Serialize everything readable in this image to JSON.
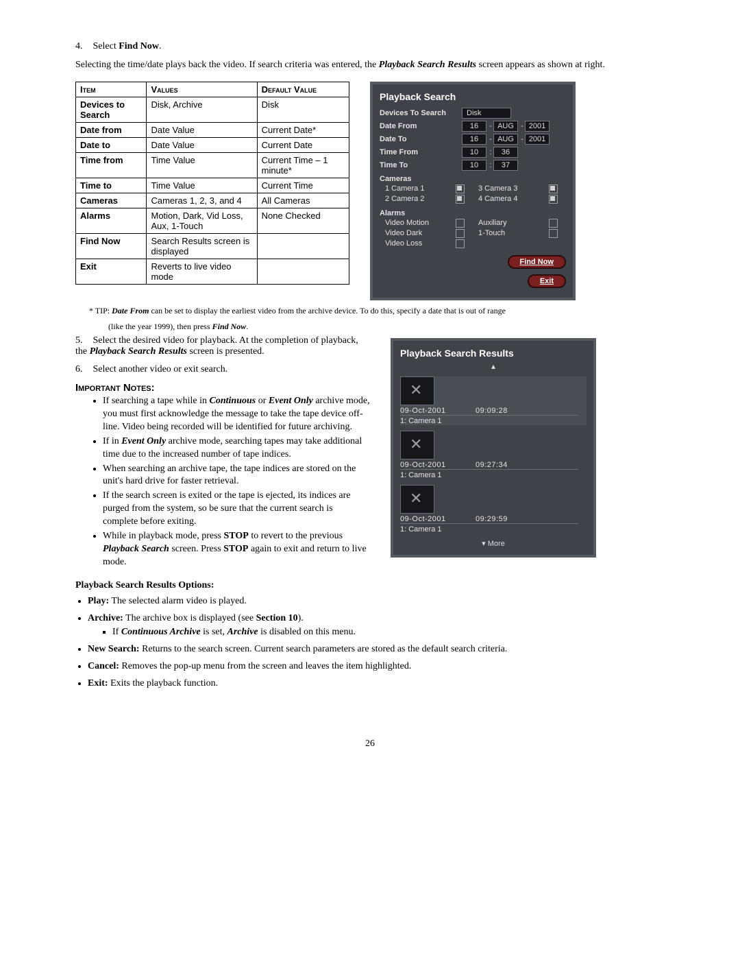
{
  "step4": {
    "num": "4.",
    "text_a": "Select ",
    "bold": "Find Now",
    "text_b": "."
  },
  "intro": {
    "a": "Selecting the time/date plays back the video. If search criteria was entered, the ",
    "bi": "Playback Search Results",
    "b": " screen appears as shown at right."
  },
  "table": {
    "headers": [
      "Item",
      "Values",
      "Default Value"
    ],
    "rows": [
      {
        "item": "Devices to Search",
        "values": "Disk, Archive",
        "default": "Disk"
      },
      {
        "item": "Date from",
        "values": "Date Value",
        "default": "Current Date*"
      },
      {
        "item": "Date to",
        "values": "Date Value",
        "default": "Current Date"
      },
      {
        "item": "Time from",
        "values": "Time Value",
        "default": "Current Time – 1 minute*"
      },
      {
        "item": "Time to",
        "values": "Time Value",
        "default": "Current Time"
      },
      {
        "item": "Cameras",
        "values": "Cameras 1, 2, 3, and 4",
        "default": "All Cameras"
      },
      {
        "item": "Alarms",
        "values": "Motion, Dark, Vid Loss, Aux, 1-Touch",
        "default": "None Checked"
      },
      {
        "item": "Find Now",
        "values": "Search Results screen is displayed",
        "default": ""
      },
      {
        "item": "Exit",
        "values": "Reverts to live video mode",
        "default": ""
      }
    ]
  },
  "tip": {
    "a": "* TIP: ",
    "bi": "Date From",
    "b": " can be set to display the earliest video from the archive device. To do this, specify a date that is out of range",
    "c": "(like the year 1999), then press ",
    "bi2": "Find Now",
    "d": "."
  },
  "step5": {
    "num": "5.",
    "a": "Select the desired video for playback. At the completion of playback, the ",
    "bi": "Playback Search Results",
    "b": " screen is presented."
  },
  "step6": {
    "num": "6.",
    "text": "Select another video or exit search."
  },
  "notes_title": "Important Notes:",
  "notes": {
    "n1a": "If searching a tape while in ",
    "n1bi1": "Continuous",
    "n1b": " or ",
    "n1bi2": "Event Only",
    "n1c": " archive mode, you must first acknowledge the message to take the tape device off-line. Video being recorded will be identified for future archiving.",
    "n2a": "If in ",
    "n2bi": "Event Only",
    "n2b": " archive mode, searching tapes may take additional time due to the increased number of tape indices.",
    "n3": "When searching an archive tape, the tape indices are stored on the unit's hard drive for faster retrieval.",
    "n4": "If the search screen is exited or the tape is ejected, its indices are purged from the system, so be sure that the current search is complete before exiting.",
    "n5a": "While in playback mode, press ",
    "n5b1": "STOP",
    "n5b": " to revert to the previous ",
    "n5bi": "Playback Search",
    "n5c": " screen. Press ",
    "n5b2": "STOP",
    "n5d": " again to exit and return to live mode."
  },
  "options_title": "Playback Search Results Options:",
  "options": {
    "play": {
      "b": "Play:",
      "t": "  The selected alarm video is played."
    },
    "archive": {
      "b": "Archive:",
      "t": "  The archive box is displayed (see ",
      "b2": "Section 10",
      "t2": ")."
    },
    "archive_sub": {
      "a": "If ",
      "bi": "Continuous Archive",
      "b": " is set, ",
      "bi2": "Archive",
      "c": " is disabled on this menu."
    },
    "newsearch": {
      "b": "New Search:",
      "t": "  Returns to the search screen. Current search parameters are stored as the default search criteria."
    },
    "cancel": {
      "b": "Cancel:",
      "t": "  Removes the pop-up menu from the screen and leaves the item highlighted."
    },
    "exit": {
      "b": "Exit:",
      "t": "  Exits the playback function."
    }
  },
  "page_number": "26",
  "ps": {
    "title": "Playback Search",
    "devices_label": "Devices To Search",
    "devices_value": "Disk",
    "date_from_label": "Date From",
    "date_to_label": "Date To",
    "df_d": "16",
    "df_m": "AUG",
    "df_y": "2001",
    "dt_d": "16",
    "dt_m": "AUG",
    "dt_y": "2001",
    "time_from_label": "Time From",
    "time_to_label": "Time To",
    "tf_h": "10",
    "tf_m": "36",
    "tt_h": "10",
    "tt_m": "37",
    "cameras_label": "Cameras",
    "cam1": "1  Camera 1",
    "cam2": "2  Camera 2",
    "cam3": "3  Camera 3",
    "cam4": "4  Camera 4",
    "alarms_label": "Alarms",
    "a_motion": "Video Motion",
    "a_dark": "Video Dark",
    "a_loss": "Video Loss",
    "a_aux": "Auxiliary",
    "a_1t": "1-Touch",
    "btn_find": "Find Now",
    "btn_exit": "Exit"
  },
  "psr": {
    "title": "Playback Search Results",
    "items": [
      {
        "date": "09-Oct-2001",
        "time": "09:09:28",
        "cam": "1: Camera 1"
      },
      {
        "date": "09-Oct-2001",
        "time": "09:27:34",
        "cam": "1: Camera 1"
      },
      {
        "date": "09-Oct-2001",
        "time": "09:29:59",
        "cam": "1: Camera 1"
      }
    ],
    "more": "More"
  }
}
